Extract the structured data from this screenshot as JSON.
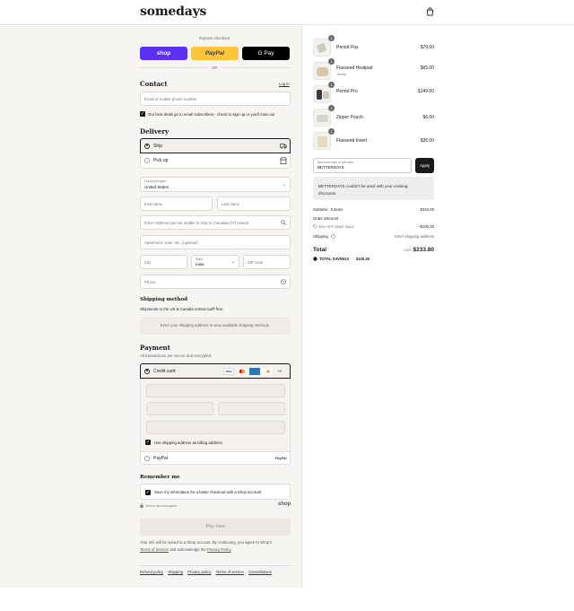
{
  "header": {
    "brand": "somedays",
    "cart_icon": "shopping-bag-icon"
  },
  "express": {
    "label": "Express checkout",
    "shop": "shop",
    "paypal": "PayPal",
    "gpay": "G Pay",
    "or": "OR",
    "colors": {
      "shop": "#5a31f4",
      "paypal": "#ffc439",
      "gpay": "#000000"
    }
  },
  "contact": {
    "title": "Contact",
    "login": "Log in",
    "email_placeholder": "Email or mobile phone number",
    "news_label": "Our best deals go to email subscribers - check to sign up or you'll miss out"
  },
  "delivery": {
    "title": "Delivery",
    "ship": "Ship",
    "pickup": "Pick up",
    "country_label": "Country/Region",
    "country_value": "United States",
    "first_name": "First name",
    "last_name": "Last name",
    "address": "Enter Address (we are unable to ship to Canadian PO boxes)",
    "apartment": "Apartment, suite, etc. (optional)",
    "city": "City",
    "state_label": "State",
    "state_value": "Iowa",
    "zip": "ZIP code",
    "phone": "Phone"
  },
  "shipping_method": {
    "title": "Shipping method",
    "note": "Shipments to the US & Canada remain tariff free.",
    "placeholder": "Enter your shipping address to view available shipping methods."
  },
  "payment": {
    "title": "Payment",
    "secure": "All transactions are secure and encrypted.",
    "credit_card": "Credit card",
    "more_cards": "+3",
    "card_brands": [
      "VISA",
      "Mastercard",
      "AMEX",
      "Discover"
    ],
    "billing_same": "Use shipping address as billing address",
    "paypal": "PayPal",
    "paypal_logo": "PayPal"
  },
  "remember": {
    "title": "Remember me",
    "save_label": "Save my information for a faster checkout with a Shop account",
    "secure_note": "Secure and encrypted",
    "shop_logo": "shop"
  },
  "pay_button": "Pay now",
  "legal": {
    "text_1": "Your info will be saved to a Shop account. By continuing, you agree to Shop's",
    "terms": "Terms of Service",
    "and": "and acknowledge the",
    "privacy": "Privacy Policy",
    "period": "."
  },
  "footer_links": [
    "Refund policy",
    "Shipping",
    "Privacy policy",
    "Terms of service",
    "Cancellations"
  ],
  "order": {
    "items": [
      {
        "name": "Period Pas",
        "variant": "",
        "qty": "1",
        "price": "$79.00"
      },
      {
        "name": "Flaxseed Heatpad",
        "variant": "Teddy",
        "qty": "1",
        "price": "$65.00"
      },
      {
        "name": "Period Pro",
        "variant": "",
        "qty": "1",
        "price": "$149.00"
      },
      {
        "name": "Zipper Pouch",
        "variant": "",
        "qty": "1",
        "price": "$6.00"
      },
      {
        "name": "Flaxseed Insert",
        "variant": "",
        "qty": "1",
        "price": "$35.00"
      }
    ],
    "discount_label": "Discount code or gift card",
    "discount_value": "BETTERDAYS",
    "apply": "Apply",
    "discount_error": "BETTERDAYS couldn't be used with your existing discounts.",
    "subtotal_label": "Subtotal · 5 items",
    "subtotal": "$334.00",
    "order_discount_label": "Order discount",
    "discount_code": "30% OFF BDAY SALE",
    "discount_amount": "−$100.20",
    "shipping_label": "Shipping",
    "shipping_value": "Enter shipping address",
    "total_label": "Total",
    "currency": "USD",
    "total": "$233.80",
    "savings_label": "TOTAL SAVINGS",
    "savings": "$100.20"
  }
}
